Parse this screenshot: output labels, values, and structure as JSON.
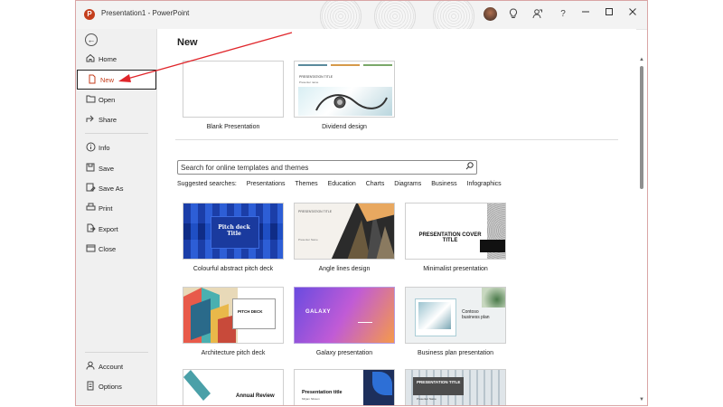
{
  "titlebar": {
    "title": "Presentation1  -  PowerPoint",
    "app_icon_letter": "P",
    "help_label": "?",
    "icons": [
      "lightbulb-icon",
      "share-person-icon",
      "help-icon",
      "minimize-icon",
      "maximize-icon",
      "close-icon"
    ]
  },
  "sidebar": {
    "items": [
      {
        "label": "Home",
        "icon": "home-icon"
      },
      {
        "label": "New",
        "icon": "new-file-icon"
      },
      {
        "label": "Open",
        "icon": "folder-icon"
      },
      {
        "label": "Share",
        "icon": "share-icon"
      },
      {
        "label": "Info",
        "icon": "info-icon"
      },
      {
        "label": "Save",
        "icon": "save-icon"
      },
      {
        "label": "Save As",
        "icon": "save-as-icon"
      },
      {
        "label": "Print",
        "icon": "print-icon"
      },
      {
        "label": "Export",
        "icon": "export-icon"
      },
      {
        "label": "Close",
        "icon": "close-folder-icon"
      },
      {
        "label": "Account",
        "icon": "account-icon"
      },
      {
        "label": "Options",
        "icon": "options-icon"
      }
    ]
  },
  "main": {
    "title": "New",
    "top_templates": [
      {
        "caption": "Blank Presentation"
      },
      {
        "caption": "Dividend design",
        "thumb_title": "PRESENTATION TITLE",
        "thumb_sub": "Presenter name"
      }
    ],
    "search": {
      "placeholder": "Search for online templates and themes"
    },
    "suggested": {
      "label": "Suggested searches:",
      "items": [
        "Presentations",
        "Themes",
        "Education",
        "Charts",
        "Diagrams",
        "Business",
        "Infographics"
      ]
    },
    "templates": [
      {
        "caption": "Colourful abstract pitch deck",
        "thumb_text": "Pitch deck Title"
      },
      {
        "caption": "Angle lines design",
        "thumb_text": "PRESENTATION TITLE",
        "thumb_sub": "Presenter Name"
      },
      {
        "caption": "Minimalist presentation",
        "thumb_text": "PRESENTATION COVER TITLE"
      },
      {
        "caption": "Architecture pitch deck",
        "thumb_text": "PITCH DECK"
      },
      {
        "caption": "Galaxy presentation",
        "thumb_text": "GALAXY"
      },
      {
        "caption": "Business plan presentation",
        "thumb_text": "Contoso business plan"
      },
      {
        "thumb_text": "Annual Review"
      },
      {
        "thumb_text": "Presentation title",
        "thumb_sub": "Mirjam Nilsson"
      },
      {
        "thumb_text": "PRESENTATION TITLE",
        "thumb_sub": "Presenter Name"
      }
    ]
  },
  "colors": {
    "accent": "#c43e1c",
    "annotation": "#e0262b"
  }
}
